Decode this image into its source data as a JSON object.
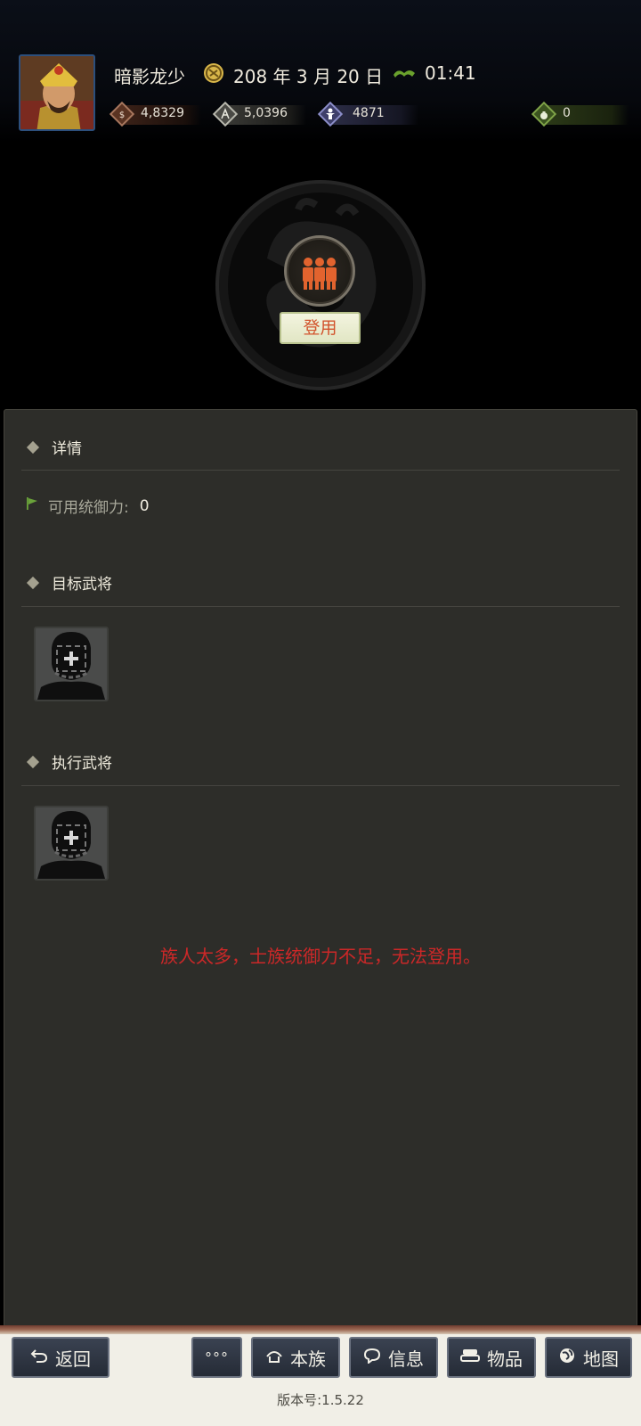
{
  "header": {
    "player_name": "暗影龙少",
    "date": "208 年 3 月 20 日",
    "time": "01:41",
    "resources": [
      {
        "icon": "money-icon",
        "value": "4,8329"
      },
      {
        "icon": "grain-icon",
        "value": "5,0396"
      },
      {
        "icon": "troops-icon",
        "value": "4871"
      },
      {
        "icon": "bag-icon",
        "value": "0"
      }
    ]
  },
  "action": {
    "label": "登用"
  },
  "details": {
    "title": "详情",
    "stat_label": "可用统御力:",
    "stat_value": "0"
  },
  "target": {
    "title": "目标武将"
  },
  "executor": {
    "title": "执行武将"
  },
  "warning": "族人太多，士族统御力不足，无法登用。",
  "footer": {
    "back_label": "返回",
    "more_label": "°°°",
    "clan_label": "本族",
    "info_label": "信息",
    "items_label": "物品",
    "map_label": "地图",
    "version": "版本号:1.5.22"
  },
  "colors": {
    "panel_bg": "#2d2d29",
    "warning": "#cc2828",
    "action_text": "#d2532c",
    "button_bg": "#2f3643"
  }
}
